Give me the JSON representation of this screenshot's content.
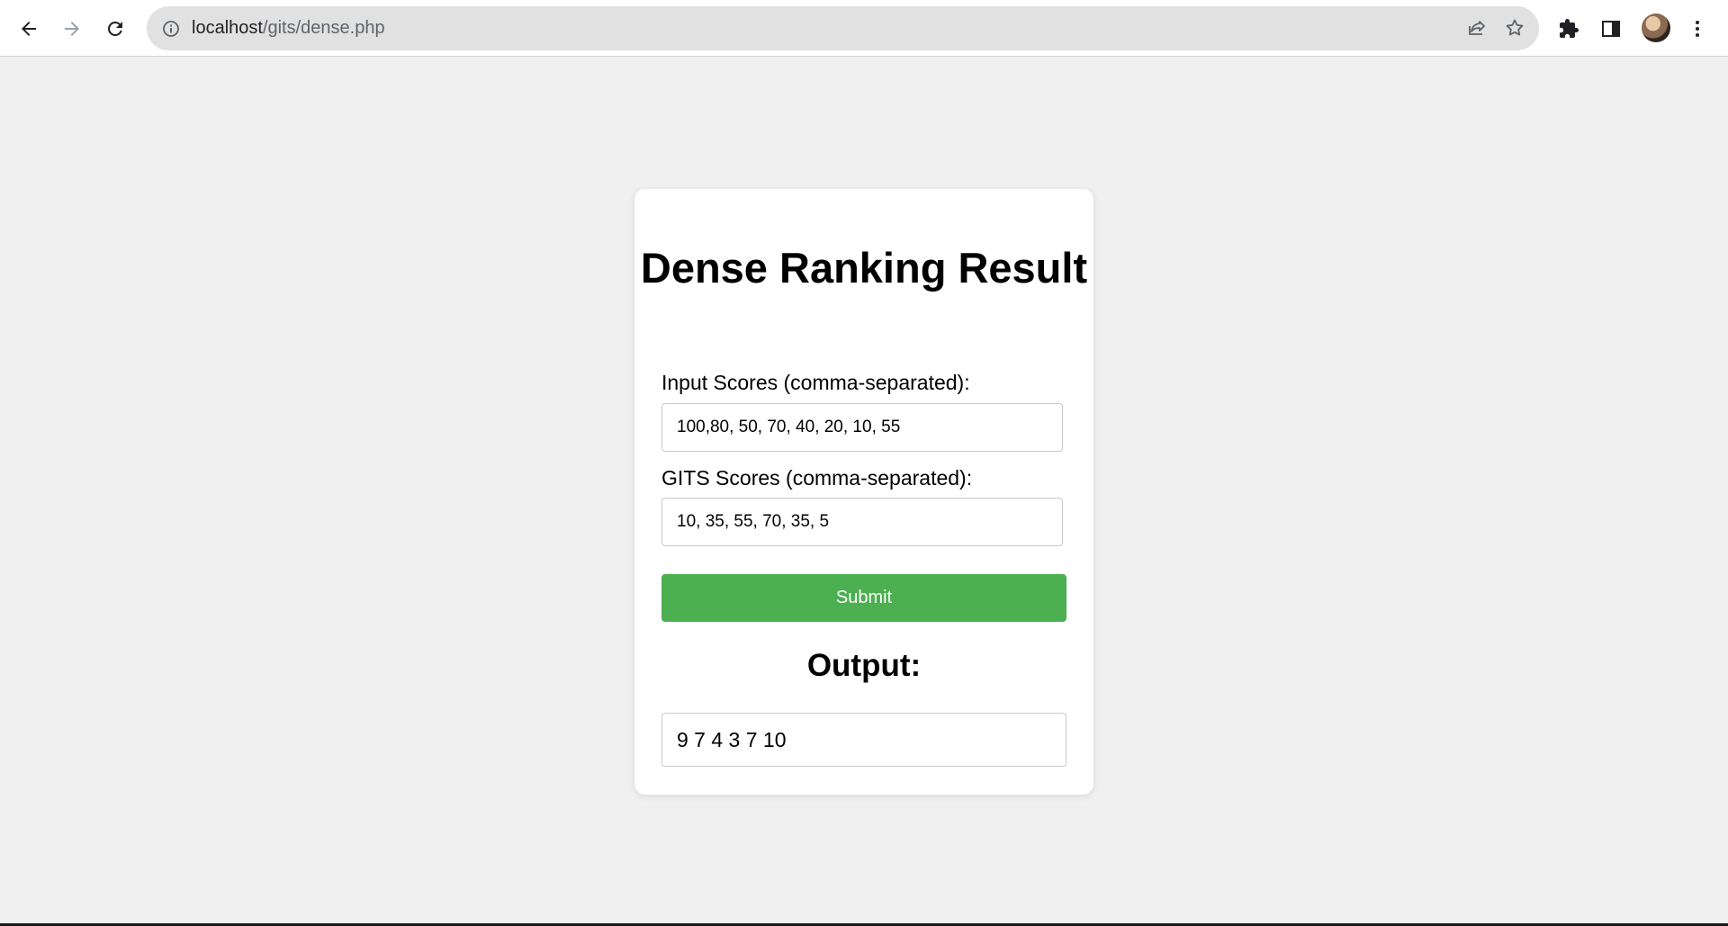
{
  "browser": {
    "url_host": "localhost",
    "url_path": "/gits/dense.php"
  },
  "form": {
    "title": "Dense Ranking Result",
    "input_label": "Input Scores (comma-separated):",
    "input_value": "100,80, 50, 70, 40, 20, 10, 55",
    "gits_label": "GITS Scores (comma-separated):",
    "gits_value": "10, 35, 55, 70, 35, 5",
    "submit_label": "Submit"
  },
  "output": {
    "heading": "Output:",
    "value": "9 7 4 3 7 10"
  },
  "colors": {
    "page_background": "#f0f0f0",
    "submit_button": "#4caf50",
    "card_background": "#ffffff"
  },
  "icons": [
    "back-arrow-icon",
    "forward-arrow-icon",
    "reload-icon",
    "info-icon",
    "share-icon",
    "star-icon",
    "extensions-puzzle-icon",
    "side-panel-icon",
    "profile-avatar",
    "menu-dots-icon"
  ]
}
